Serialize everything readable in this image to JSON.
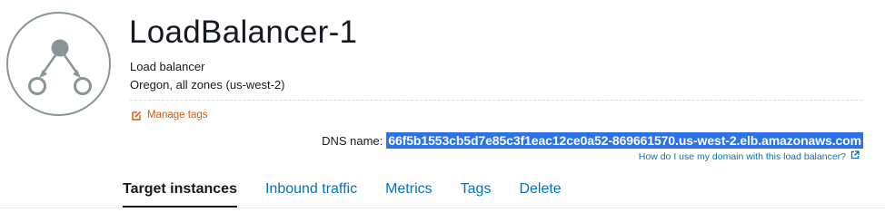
{
  "header": {
    "title": "LoadBalancer-1",
    "type": "Load balancer",
    "region": "Oregon, all zones (us-west-2)",
    "icon": "load-balancer-icon"
  },
  "manage_tags": {
    "label": "Manage tags",
    "icon": "edit-icon",
    "color": "#d45b07"
  },
  "dns": {
    "label": "DNS name:",
    "value": "66f5b1553cb5d7e85c3f1eac12ce0a52-869661570.us-west-2.elb.amazonaws.com",
    "help_link": "How do I use my domain with this load balancer?",
    "help_icon": "external-link-icon"
  },
  "tabs": [
    {
      "label": "Target instances",
      "active": true
    },
    {
      "label": "Inbound traffic",
      "active": false
    },
    {
      "label": "Metrics",
      "active": false
    },
    {
      "label": "Tags",
      "active": false
    },
    {
      "label": "Delete",
      "active": false
    }
  ],
  "colors": {
    "link": "#0073bb",
    "highlight": "#2b71e8",
    "icon_gray": "#879596"
  }
}
